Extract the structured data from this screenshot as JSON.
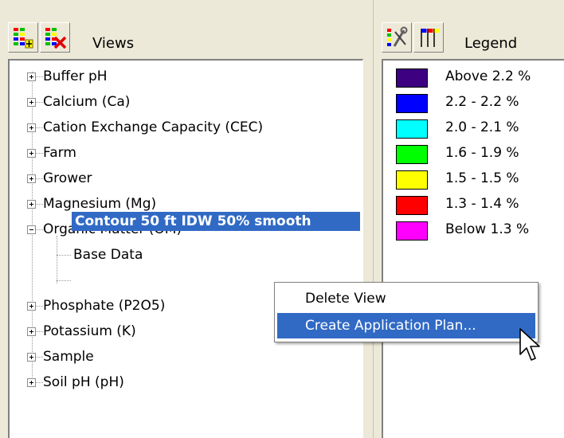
{
  "views": {
    "title": "Views",
    "toolbar": {
      "add_icon": "add-view-icon",
      "delete_icon": "delete-view-icon"
    },
    "tree": [
      {
        "label": "Buffer pH",
        "expanded": false
      },
      {
        "label": "Calcium (Ca)",
        "expanded": false
      },
      {
        "label": "Cation Exchange Capacity (CEC)",
        "expanded": false
      },
      {
        "label": "Farm",
        "expanded": false
      },
      {
        "label": "Grower",
        "expanded": false
      },
      {
        "label": "Magnesium (Mg)",
        "expanded": false
      },
      {
        "label": "Organic Matter (OM)",
        "expanded": true,
        "children": [
          {
            "label": "Base Data",
            "selected": false
          },
          {
            "label": "Contour 50 ft IDW 50% smooth",
            "selected": true
          }
        ]
      },
      {
        "label": "Phosphate (P2O5)",
        "expanded": false
      },
      {
        "label": "Potassium (K)",
        "expanded": false
      },
      {
        "label": "Sample",
        "expanded": false
      },
      {
        "label": "Soil pH (pH)",
        "expanded": false
      }
    ]
  },
  "legend": {
    "title": "Legend",
    "toolbar": {
      "properties_icon": "legend-properties-icon",
      "flags_icon": "legend-flags-icon"
    },
    "items": [
      {
        "label": "Above 2.2 %",
        "color": "#3c0080"
      },
      {
        "label": "2.2 - 2.2 %",
        "color": "#0000ff"
      },
      {
        "label": "2.0 - 2.1 %",
        "color": "#00ffff"
      },
      {
        "label": "1.6 - 1.9 %",
        "color": "#00ff00"
      },
      {
        "label": "1.5 - 1.5 %",
        "color": "#ffff00"
      },
      {
        "label": "1.3 - 1.4 %",
        "color": "#ff0000"
      },
      {
        "label": "Below 1.3 %",
        "color": "#ff00ff"
      }
    ]
  },
  "context_menu": {
    "items": [
      {
        "label": "Delete View",
        "highlighted": false
      },
      {
        "label": "Create Application Plan...",
        "highlighted": true
      }
    ]
  },
  "colors": {
    "selection": "#316ac5",
    "panel_bg": "#ece9d8"
  }
}
